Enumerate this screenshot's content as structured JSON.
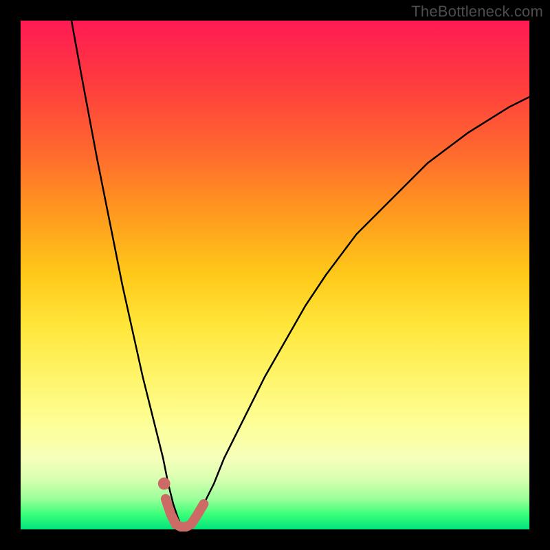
{
  "watermark": "TheBottleneck.com",
  "chart_data": {
    "type": "line",
    "title": "",
    "xlabel": "",
    "ylabel": "",
    "xlim": [
      0,
      100
    ],
    "ylim": [
      0,
      100
    ],
    "grid": false,
    "series": [
      {
        "name": "bottleneck-curve",
        "color": "#000000",
        "x": [
          10,
          12,
          15,
          18,
          20,
          22,
          24,
          26,
          28,
          29,
          30,
          31,
          32,
          33,
          34,
          36,
          38,
          40,
          44,
          48,
          52,
          56,
          60,
          66,
          72,
          80,
          88,
          96,
          100
        ],
        "values": [
          100,
          89,
          73,
          58,
          48,
          39,
          30,
          22,
          14,
          9,
          5,
          2,
          0,
          0,
          2,
          5,
          9,
          14,
          22,
          30,
          37,
          44,
          50,
          58,
          64,
          72,
          78,
          83,
          85
        ]
      },
      {
        "name": "flat-highlight",
        "color": "#cc6b66",
        "x": [
          28.5,
          29.5,
          30.5,
          31.5,
          32.5,
          33.5,
          34.5,
          36.0
        ],
        "values": [
          6.0,
          3.0,
          1.0,
          0.5,
          0.5,
          1.0,
          2.5,
          5.0
        ]
      }
    ],
    "markers": [
      {
        "name": "dot-left",
        "x": 28.2,
        "y": 9.0,
        "color": "#cc6b66",
        "r": 1.2
      }
    ]
  }
}
